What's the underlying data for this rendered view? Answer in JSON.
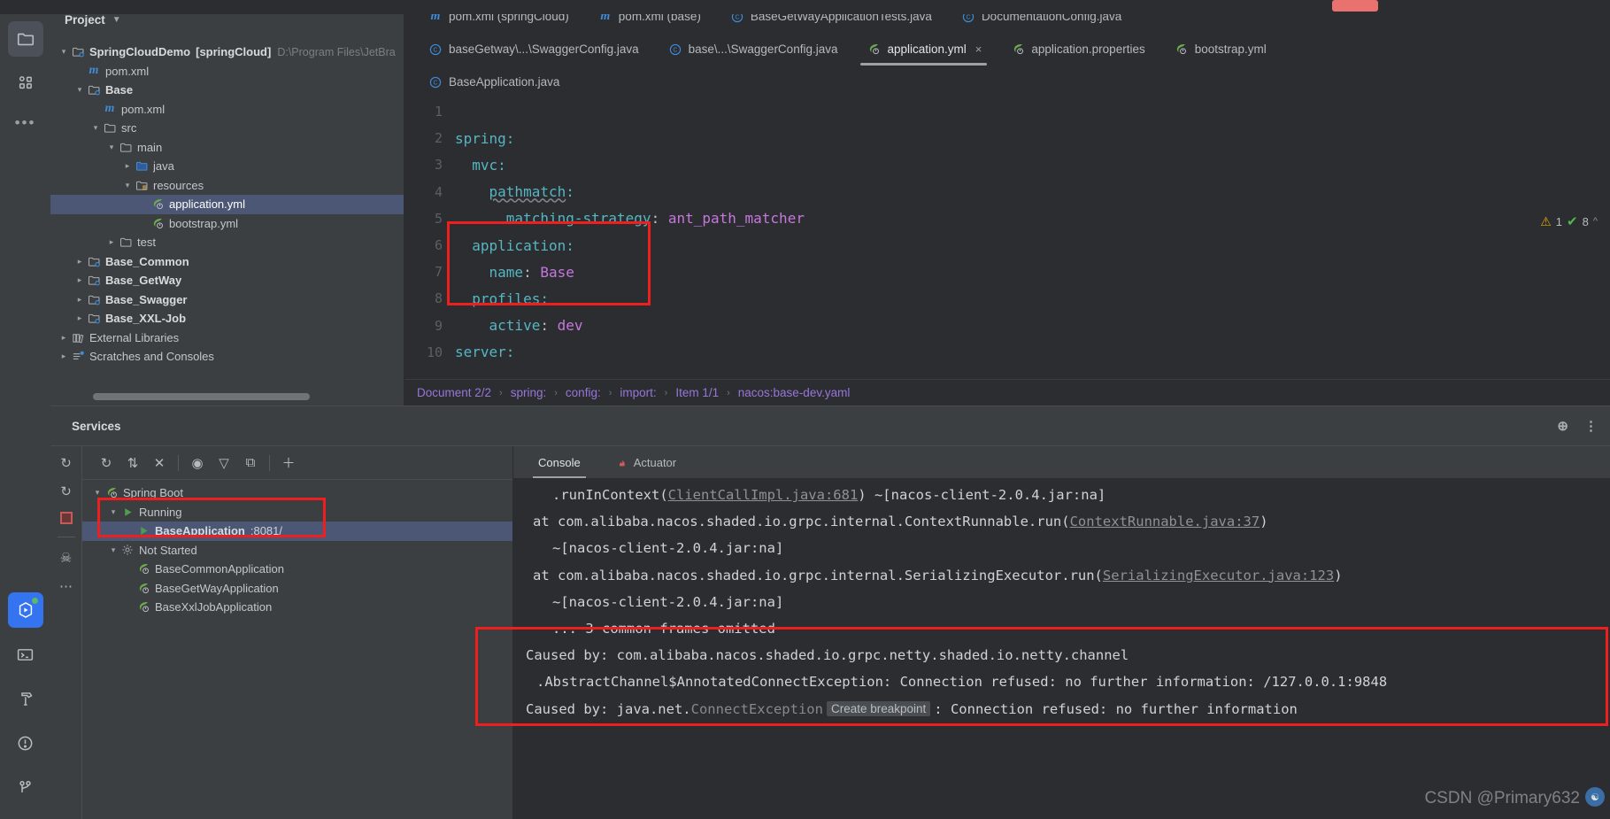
{
  "activity_bar": {
    "items": [
      {
        "name": "project-tool-window",
        "icon": "folder-icon",
        "selected": true
      },
      {
        "name": "commit-tool-window",
        "icon": "grid-icon",
        "selected": false
      },
      {
        "name": "more-tool-windows",
        "icon": "ellipsis-icon",
        "selected": false
      }
    ],
    "bottom_items": [
      {
        "name": "services-tool-window",
        "icon": "run-services-icon",
        "selected": true
      },
      {
        "name": "terminal-tool-window",
        "icon": "terminal-icon",
        "selected": false
      },
      {
        "name": "build-tool-window",
        "icon": "hammer-icon",
        "selected": false
      },
      {
        "name": "problems-tool-window",
        "icon": "warning-circle-icon",
        "selected": false
      },
      {
        "name": "version-control-tool-window",
        "icon": "branch-icon",
        "selected": false
      }
    ]
  },
  "project": {
    "title": "Project",
    "tree": [
      {
        "label": "SpringCloudDemo",
        "module": "[springCloud]",
        "path": "D:\\Program Files\\JetBra",
        "indent": 0,
        "arrow": "open",
        "icon": "module-icon",
        "bold": true
      },
      {
        "label": "pom.xml",
        "indent": 1,
        "arrow": "none",
        "icon": "maven-icon"
      },
      {
        "label": "Base",
        "indent": 1,
        "arrow": "open",
        "icon": "module-icon",
        "bold": true
      },
      {
        "label": "pom.xml",
        "indent": 2,
        "arrow": "none",
        "icon": "maven-icon"
      },
      {
        "label": "src",
        "indent": 2,
        "arrow": "open",
        "icon": "folder-icon"
      },
      {
        "label": "main",
        "indent": 3,
        "arrow": "open",
        "icon": "folder-icon"
      },
      {
        "label": "java",
        "indent": 4,
        "arrow": "closed",
        "icon": "source-folder-icon"
      },
      {
        "label": "resources",
        "indent": 4,
        "arrow": "open",
        "icon": "resource-folder-icon"
      },
      {
        "label": "application.yml",
        "indent": 5,
        "arrow": "none",
        "icon": "spring-yaml-icon",
        "selected": true
      },
      {
        "label": "bootstrap.yml",
        "indent": 5,
        "arrow": "none",
        "icon": "spring-yaml-icon"
      },
      {
        "label": "test",
        "indent": 3,
        "arrow": "closed",
        "icon": "folder-icon"
      },
      {
        "label": "Base_Common",
        "indent": 1,
        "arrow": "closed",
        "icon": "module-icon",
        "bold": true
      },
      {
        "label": "Base_GetWay",
        "indent": 1,
        "arrow": "closed",
        "icon": "module-icon",
        "bold": true
      },
      {
        "label": "Base_Swagger",
        "indent": 1,
        "arrow": "closed",
        "icon": "module-icon",
        "bold": true
      },
      {
        "label": "Base_XXL-Job",
        "indent": 1,
        "arrow": "closed",
        "icon": "module-icon",
        "bold": true
      },
      {
        "label": "External Libraries",
        "indent": 0,
        "arrow": "closed",
        "icon": "libraries-icon"
      },
      {
        "label": "Scratches and Consoles",
        "indent": 0,
        "arrow": "closed",
        "icon": "scratches-icon"
      }
    ]
  },
  "editor": {
    "tab_rows": [
      [
        {
          "label": "pom.xml (springCloud)",
          "icon": "maven-icon",
          "active": false
        },
        {
          "label": "pom.xml (base)",
          "icon": "maven-icon",
          "active": false
        },
        {
          "label": "BaseGetWayApplicationTests.java",
          "icon": "java-class-icon",
          "active": false
        },
        {
          "label": "DocumentationConfig.java",
          "icon": "java-class-icon",
          "active": false
        }
      ],
      [
        {
          "label": "baseGetway\\...\\SwaggerConfig.java",
          "icon": "java-class-icon",
          "active": false
        },
        {
          "label": "base\\...\\SwaggerConfig.java",
          "icon": "java-class-icon",
          "active": false
        },
        {
          "label": "application.yml",
          "icon": "spring-yaml-icon",
          "active": true,
          "closable": true,
          "close_label": "×"
        },
        {
          "label": "application.properties",
          "icon": "spring-yaml-icon",
          "active": false
        },
        {
          "label": "bootstrap.yml",
          "icon": "spring-yaml-icon",
          "active": false
        }
      ],
      [
        {
          "label": "BaseApplication.java",
          "icon": "java-class-icon",
          "active": false
        }
      ]
    ],
    "lines": [
      {
        "num": "1",
        "segments": []
      },
      {
        "num": "2",
        "segments": [
          {
            "t": "spring:",
            "c": "k-key"
          }
        ],
        "indent": 0
      },
      {
        "num": "3",
        "segments": [
          {
            "t": "  mvc:",
            "c": "k-key"
          }
        ]
      },
      {
        "num": "4",
        "segments": [
          {
            "t": "    ",
            "c": "k-plain"
          },
          {
            "t": "pathmatch",
            "c": "k-underline"
          },
          {
            "t": ":",
            "c": "k-key"
          }
        ]
      },
      {
        "num": "5",
        "segments": [
          {
            "t": "      matching-strategy",
            "c": "k-key"
          },
          {
            "t": ": ",
            "c": "k-plain"
          },
          {
            "t": "ant_path_matcher",
            "c": "k-val"
          }
        ]
      },
      {
        "num": "6",
        "segments": [
          {
            "t": "  application:",
            "c": "k-key"
          }
        ]
      },
      {
        "num": "7",
        "segments": [
          {
            "t": "    name",
            "c": "k-key"
          },
          {
            "t": ": ",
            "c": "k-plain"
          },
          {
            "t": "Base",
            "c": "k-val"
          }
        ]
      },
      {
        "num": "8",
        "segments": [
          {
            "t": "  profiles:",
            "c": "k-key"
          }
        ]
      },
      {
        "num": "9",
        "segments": [
          {
            "t": "    active",
            "c": "k-key"
          },
          {
            "t": ": ",
            "c": "k-plain"
          },
          {
            "t": "dev",
            "c": "k-val"
          }
        ]
      },
      {
        "num": "10",
        "segments": [
          {
            "t": "server:",
            "c": "k-key"
          }
        ]
      }
    ],
    "inspection": {
      "warning_count": "1",
      "warning_icon": "warning-triangle-icon",
      "ok_count": "8",
      "ok_icon": "double-check-icon",
      "collapse_icon": "chevron-up-icon"
    },
    "breadcrumbs": [
      "Document 2/2",
      "spring:",
      "config:",
      "import:",
      "Item 1/1",
      "nacos:base-dev.yaml"
    ],
    "breadcrumb_separator": "›"
  },
  "services": {
    "title": "Services",
    "header_icons": [
      {
        "name": "help-target-icon",
        "glyph": "⊕"
      },
      {
        "name": "options-menu-icon",
        "glyph": "⋮"
      }
    ],
    "side_icons": [
      {
        "name": "rerun-icon",
        "glyph": "↻"
      },
      {
        "name": "rerun-debug-icon",
        "glyph": "↻"
      },
      {
        "name": "stop-icon",
        "glyph": ""
      },
      {
        "name": "thread-dump-icon",
        "glyph": "☸"
      },
      {
        "name": "more-actions-icon",
        "glyph": "⋯"
      }
    ],
    "toolbar": [
      {
        "name": "refresh-button",
        "glyph": "↻"
      },
      {
        "name": "expand-collapse-button",
        "glyph": "⬍"
      },
      {
        "name": "close-button",
        "glyph": "✕"
      },
      {
        "name": "show-hide-button",
        "glyph": "◉"
      },
      {
        "name": "filter-button",
        "glyph": "∇"
      },
      {
        "name": "new-tab-button",
        "glyph": "⧉"
      },
      {
        "name": "add-button",
        "glyph": "＋"
      }
    ],
    "tree": [
      {
        "label": "Spring Boot",
        "indent": 0,
        "arrow": "open",
        "icon": "spring-boot-icon"
      },
      {
        "label": "Running",
        "indent": 1,
        "arrow": "open",
        "icon": "run-icon"
      },
      {
        "label": "BaseApplication",
        "port": ":8081/",
        "indent": 2,
        "arrow": "none",
        "icon": "run-green-icon",
        "selected": true,
        "bold": true
      },
      {
        "label": "Not Started",
        "indent": 1,
        "arrow": "open",
        "icon": "not-started-icon"
      },
      {
        "label": "BaseCommonApplication",
        "indent": 2,
        "arrow": "none",
        "icon": "spring-boot-icon"
      },
      {
        "label": "BaseGetWayApplication",
        "indent": 2,
        "arrow": "none",
        "icon": "spring-boot-icon"
      },
      {
        "label": "BaseXxlJobApplication",
        "indent": 2,
        "arrow": "none",
        "icon": "spring-boot-icon"
      }
    ],
    "console_tabs": [
      {
        "label": "Console",
        "icon": "",
        "active": true
      },
      {
        "label": "Actuator",
        "icon": "actuator-icon",
        "active": false
      }
    ],
    "console_lines": [
      {
        "indent": 44,
        "segments": [
          {
            "t": ".runInContext(",
            "c": ""
          },
          {
            "t": "ClientCallImpl.java:681",
            "c": "clink"
          },
          {
            "t": ") ~[nacos-client-2.0.4.jar:na]",
            "c": ""
          }
        ]
      },
      {
        "indent": 22,
        "segments": [
          {
            "t": "at com.alibaba.nacos.shaded.io.grpc.internal.ContextRunnable.run(",
            "c": ""
          },
          {
            "t": "ContextRunnable.java:37",
            "c": "clink"
          },
          {
            "t": ")",
            "c": ""
          }
        ]
      },
      {
        "indent": 44,
        "segments": [
          {
            "t": "~[nacos-client-2.0.4.jar:na]",
            "c": ""
          }
        ]
      },
      {
        "indent": 22,
        "segments": [
          {
            "t": "at com.alibaba.nacos.shaded.io.grpc.internal.SerializingExecutor.run(",
            "c": ""
          },
          {
            "t": "SerializingExecutor.java:123",
            "c": "clink"
          },
          {
            "t": ")",
            "c": ""
          }
        ]
      },
      {
        "indent": 44,
        "segments": [
          {
            "t": "~[nacos-client-2.0.4.jar:na]",
            "c": ""
          }
        ]
      },
      {
        "indent": 44,
        "segments": [
          {
            "t": "... 3 common frames omitted",
            "c": ""
          }
        ]
      },
      {
        "indent": 14,
        "segments": [
          {
            "t": "Caused by: com.alibaba.nacos.shaded.io.grpc.netty.shaded.io.netty.channel",
            "c": ""
          }
        ]
      },
      {
        "indent": 26,
        "segments": [
          {
            "t": ".AbstractChannel$AnnotatedConnectException: Connection refused: no further information: /127.0.0.1:9848",
            "c": ""
          }
        ]
      },
      {
        "indent": 14,
        "segments": [
          {
            "t": "Caused by: java.net.",
            "c": ""
          },
          {
            "t": "ConnectException",
            "c": "cdim"
          },
          {
            "t": "__BP__",
            "c": "bp",
            "bp_label": "Create breakpoint"
          },
          {
            "t": ": Connection refused: no further information",
            "c": ""
          }
        ]
      }
    ]
  },
  "watermark": {
    "text": "CSDN @Primary632"
  },
  "annotations": {
    "code_box": {
      "note": "red highlight around application name block"
    },
    "service_box": {
      "note": "red highlight around running BaseApplication"
    },
    "console_box": {
      "note": "red highlight around Caused by error lines"
    }
  }
}
